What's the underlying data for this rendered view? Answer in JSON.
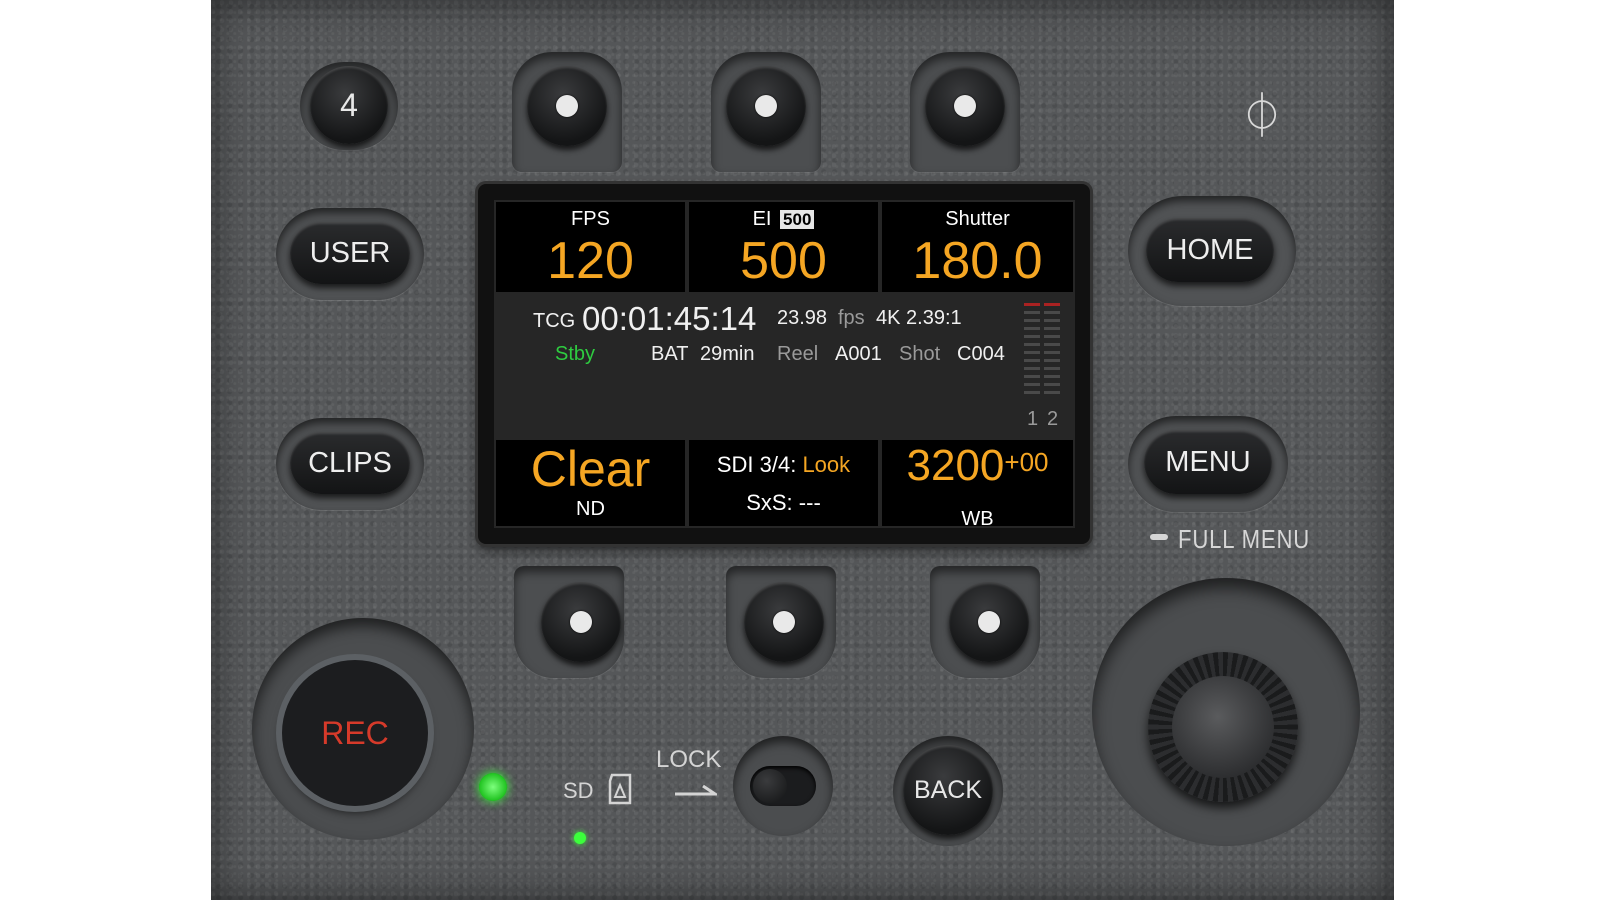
{
  "panel": {
    "top_button_1_label": "4",
    "user_label": "USER",
    "clips_label": "CLIPS",
    "home_label": "HOME",
    "menu_label": "MENU",
    "full_menu_label": "FULL MENU",
    "rec_label": "REC",
    "back_label": "BACK",
    "lock_label": "LOCK",
    "sd_label": "SD",
    "power_symbol": "⏀"
  },
  "display": {
    "fps": {
      "label": "FPS",
      "value": "120"
    },
    "ei": {
      "label": "EI",
      "badge": "500",
      "value": "500"
    },
    "shutter": {
      "label": "Shutter",
      "value": "180.0"
    },
    "tcg_label": "TCG",
    "timecode": "00:01:45:14",
    "project_fps": "23.98",
    "fps_unit": "fps",
    "format": "4K 2.39:1",
    "status": "Stby",
    "bat_label": "BAT",
    "bat_value": "29min",
    "reel_label": "Reel",
    "reel_value": "A001",
    "shot_label": "Shot",
    "shot_value": "C004",
    "meter_ch1": "1",
    "meter_ch2": "2",
    "nd": {
      "value": "Clear",
      "label": "ND"
    },
    "sdi_label": "SDI 3/4:",
    "sdi_value": "Look",
    "sxs_label": "SxS:",
    "sxs_value": "---",
    "wb": {
      "value": "3200",
      "tint": "+00",
      "label": "WB"
    }
  },
  "colors": {
    "accent": "#f5a623",
    "status_green": "#2ecc40",
    "rec_red": "#d63a2a",
    "led_green": "#3cff3c"
  }
}
